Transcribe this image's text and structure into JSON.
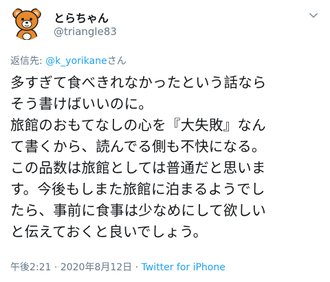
{
  "user": {
    "display_name": "とらちゃん",
    "handle": "@triangle83",
    "avatar_icon": "bear-avatar-icon"
  },
  "reply": {
    "prefix": "返信先: ",
    "mention": "@k_yorikane",
    "suffix": "さん"
  },
  "tweet": {
    "lines": [
      "多すぎて食べきれなかったという話なら",
      "そう書けばいいのに。",
      "旅館のおもてなしの心を『大失敗』なん",
      "て書くから、読んでる側も不快になる。",
      "この品数は旅館としては普通だと思いま",
      "す。今後もしまた旅館に泊まるようでし",
      "たら、事前に食事は少なめにして欲しい",
      "と伝えておくと良いでしょう。"
    ]
  },
  "meta": {
    "time": "午後2:21",
    "separator1": " · ",
    "date": "2020年8月12日",
    "separator2": " · ",
    "source": "Twitter for iPhone"
  },
  "colors": {
    "link": "#1da1f2",
    "secondary": "#657786",
    "text": "#14171a",
    "avatar_bear": "#e8892b"
  },
  "icons": {
    "menu": "chevron-down-icon"
  }
}
